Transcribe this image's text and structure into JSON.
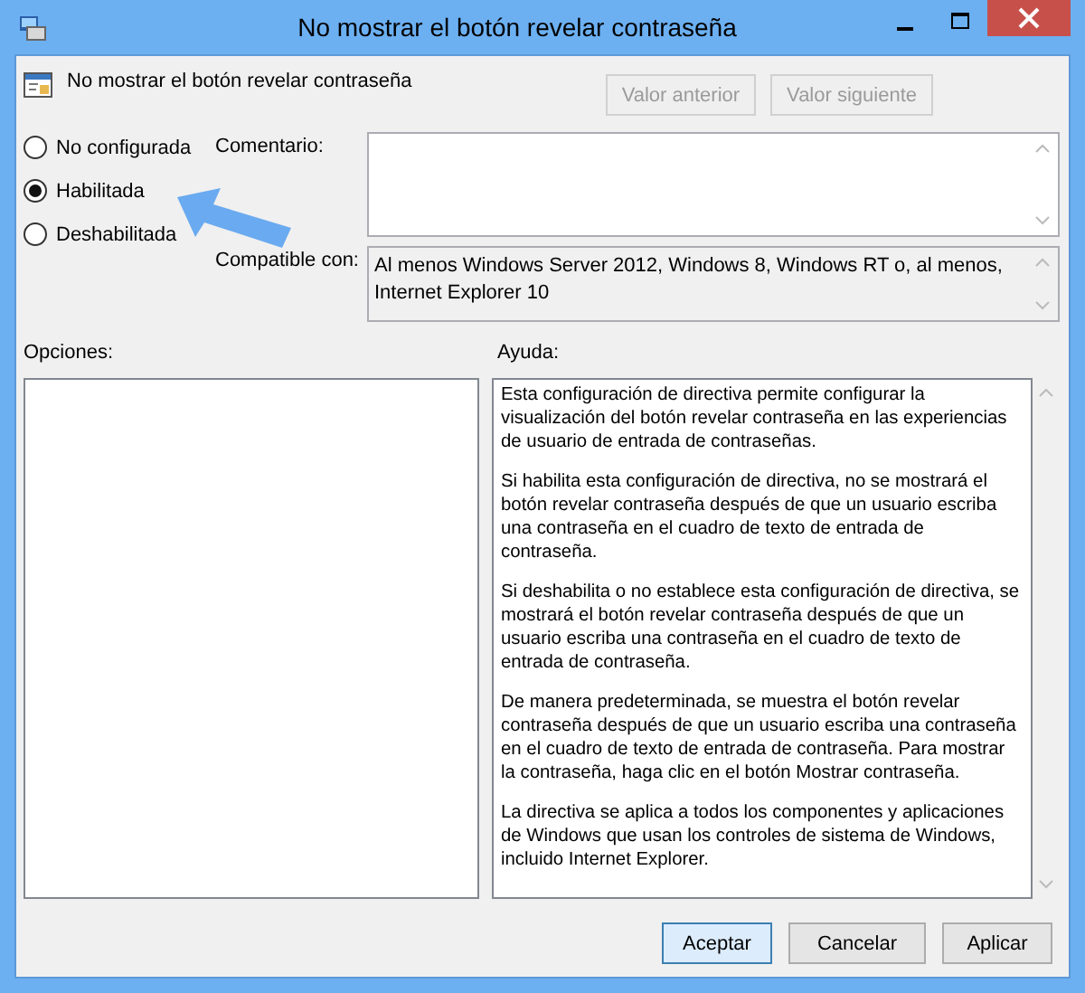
{
  "window": {
    "title": "No mostrar el botón revelar contraseña"
  },
  "header": {
    "title": "No mostrar el botón revelar contraseña"
  },
  "nav_buttons": [
    {
      "label": "Valor anterior",
      "disabled": true
    },
    {
      "label": "Valor siguiente",
      "disabled": true
    }
  ],
  "options": [
    {
      "label": "No configurada",
      "selected": false
    },
    {
      "label": "Habilitada",
      "selected": true
    },
    {
      "label": "Deshabilitada",
      "selected": false
    }
  ],
  "comment": {
    "label": "Comentario:"
  },
  "compatible": {
    "label": "Compatible con:",
    "value": "Al menos Windows Server 2012, Windows 8, Windows RT o, al menos, Internet Explorer 10"
  },
  "options_label": "Opciones:",
  "help": {
    "label": "Ayuda:",
    "paragraphs": [
      "Esta configuración de directiva permite configurar la visualización del botón revelar contraseña en las experiencias de usuario de entrada de contraseñas.",
      "Si habilita esta configuración de directiva, no se mostrará el botón revelar contraseña después de que un usuario escriba una contraseña en el cuadro de texto de entrada de contraseña.",
      "Si deshabilita o no establece esta configuración de directiva, se mostrará el botón revelar contraseña después de que un usuario escriba una contraseña en el cuadro de texto de entrada de contraseña.",
      "De manera predeterminada, se muestra el botón revelar contraseña después de que un usuario escriba una contraseña en el cuadro de texto de entrada de contraseña. Para mostrar la contraseña, haga clic en el botón Mostrar contraseña.",
      "La directiva se aplica a todos los componentes y aplicaciones de Windows que usan los controles de sistema de Windows, incluido Internet Explorer."
    ]
  },
  "buttons": [
    {
      "label": "Aceptar",
      "default": true
    },
    {
      "label": "Cancelar",
      "default": false
    },
    {
      "label": "Aplicar",
      "default": false
    }
  ]
}
